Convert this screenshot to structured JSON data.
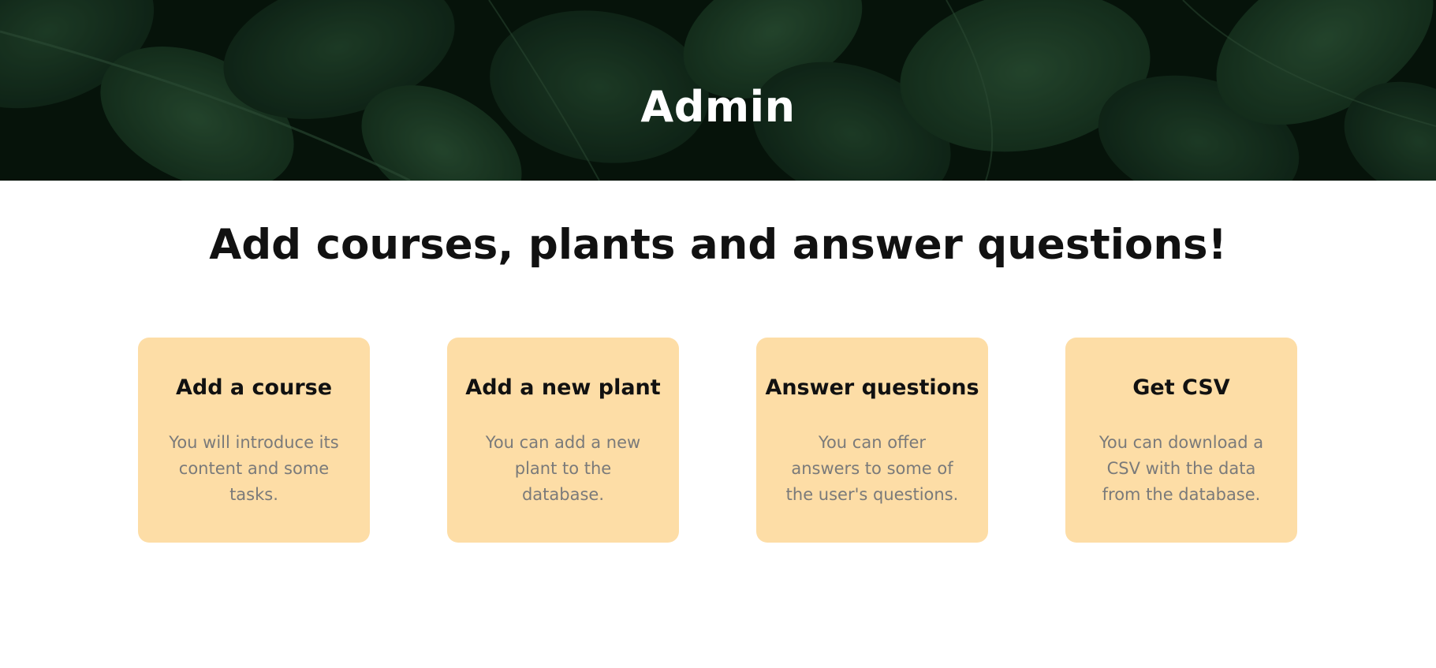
{
  "hero": {
    "title": "Admin",
    "background_color": "#0c2414"
  },
  "main": {
    "headline": "Add courses, plants and answer questions!"
  },
  "cards": [
    {
      "title": "Add a course",
      "description": "You will introduce its content and some tasks."
    },
    {
      "title": "Add a new plant",
      "description": "You can add a new plant to the database."
    },
    {
      "title": "Answer questions",
      "description": "You can offer answers to some of the user's questions."
    },
    {
      "title": "Get CSV",
      "description": "You can download a CSV with the data from the database."
    }
  ],
  "colors": {
    "card_background": "#fddda6",
    "heading_text": "#111111",
    "description_text": "#7a7a7a",
    "hero_text": "#ffffff"
  }
}
